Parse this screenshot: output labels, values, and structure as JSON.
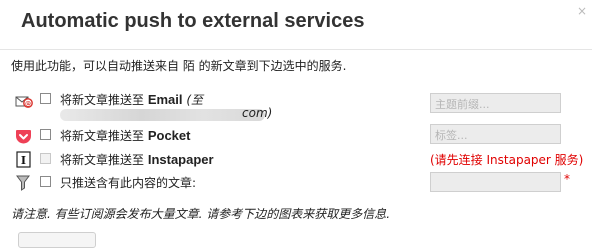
{
  "dialog": {
    "title": "Automatic push to external services",
    "close_glyph": "×",
    "intro": "使用此功能，可以自动推送来自 陌 的新文章到下边选中的服务.",
    "note": "请注意. 有些订阅源会发布大量文章. 请参考下边的图表来获取更多信息."
  },
  "services": [
    {
      "icon": "email-icon",
      "label_prefix": "将新文章推送至 ",
      "label_bold": "Email",
      "label_suffix": " (至",
      "label_cont": "com)",
      "checked": false,
      "disabled": false,
      "field_placeholder": "主题前缀..."
    },
    {
      "icon": "pocket-icon",
      "label_prefix": "将新文章推送至 ",
      "label_bold": "Pocket",
      "checked": false,
      "disabled": false,
      "field_placeholder": "标签..."
    },
    {
      "icon": "instapaper-icon",
      "label_prefix": "将新文章推送至 ",
      "label_bold": "Instapaper",
      "checked": false,
      "disabled": true,
      "status_message": "(请先连接 Instapaper 服务)"
    },
    {
      "icon": "filter-icon",
      "label_prefix": "只推送含有此内容的文章:",
      "checked": false,
      "disabled": false,
      "field_placeholder": "",
      "required_marker": "*"
    }
  ],
  "colors": {
    "error": "#e00000",
    "pocket": "#ee4056",
    "email_red": "#d9312b",
    "field_bg": "#ececec"
  }
}
